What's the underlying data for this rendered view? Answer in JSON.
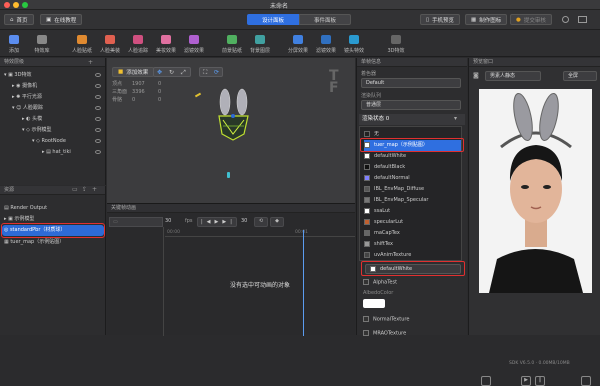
{
  "window": {
    "title": "未命名"
  },
  "topbar": {
    "home": "首页",
    "tutorial": "在线教程",
    "tab_design": "设计面板",
    "tab_event": "事件面板",
    "phone_preview": "手机预览",
    "make_icon": "制作图标",
    "submit_review": "提交审核"
  },
  "toolbar": [
    {
      "label": "添加"
    },
    {
      "label": "特效库"
    },
    {
      "label": "人脸贴纸"
    },
    {
      "label": "人脸美装"
    },
    {
      "label": "人脸追踪"
    },
    {
      "label": "美妆效果"
    },
    {
      "label": "滤镜效果"
    },
    {
      "label": "前景贴纸"
    },
    {
      "label": "背景图层"
    },
    {
      "label": "分屏效果"
    },
    {
      "label": "滤镜效果"
    },
    {
      "label": "镜头特效"
    },
    {
      "label": "3D特效"
    }
  ],
  "hierarchy": {
    "header": "特效层级",
    "items": [
      {
        "label": "3D特效"
      },
      {
        "label": "摄像机"
      },
      {
        "label": "平行光源"
      },
      {
        "label": "人脸跟踪"
      },
      {
        "label": "头模"
      },
      {
        "label": "示例模型"
      },
      {
        "label": "RootNode"
      },
      {
        "label": "hat_tiki"
      }
    ]
  },
  "resources": {
    "header": "资源",
    "items": [
      {
        "label": "Render Output"
      },
      {
        "label": "示例模型"
      },
      {
        "label": "standardPbr（材质球）"
      },
      {
        "label": "tuer_map（示例贴图）"
      }
    ]
  },
  "viewport": {
    "add_effect": "添加效果",
    "stats": [
      {
        "k": "顶点",
        "v": "1907",
        "x": "0"
      },
      {
        "k": "三角面",
        "v": "3396",
        "x": "0"
      },
      {
        "k": "骨骼",
        "v": "0",
        "x": "0"
      }
    ]
  },
  "timeline": {
    "header": "关键帧动画",
    "frames": "30",
    "fps_label": "fps",
    "frame_val": "30",
    "empty_msg": "没有选中可动画的对象",
    "ticks": [
      "00:00",
      "00:01"
    ]
  },
  "material": {
    "header": "单帧信息",
    "blend_label": "着色器",
    "blend_value": "Default",
    "queue_label": "渲染队列",
    "queue_value": "普通层",
    "state_label": "渲染状态 0",
    "list": [
      {
        "label": "无",
        "color": "#222222"
      },
      {
        "label": "tuer_map（示例贴图）",
        "color": "#ffffff"
      },
      {
        "label": "defaultWhite",
        "color": "#ffffff"
      },
      {
        "label": "defaultBlack",
        "color": "#111111"
      },
      {
        "label": "defaultNormal",
        "color": "#8080ff"
      },
      {
        "label": "IBL_EnvMap_Diffuse",
        "color": "#555555"
      },
      {
        "label": "IBL_EnvMap_Specular",
        "color": "#777777"
      },
      {
        "label": "ssaLut",
        "color": "#ffffff"
      },
      {
        "label": "specularLut",
        "color": "#c06030"
      },
      {
        "label": "maCapTex",
        "color": "#666666"
      },
      {
        "label": "shiftTex",
        "color": "#999999"
      },
      {
        "label": "uvAnimTexture",
        "color": "#444444"
      }
    ],
    "selected_tex": "defaultWhite",
    "alpha_test": "AlphaTest",
    "albedo_label": "AlbedoColor",
    "normal_tex": "NormalTexture",
    "mrao_tex": "MRAOTexture"
  },
  "preview": {
    "header": "预览窗口",
    "model_select": "男素人静态",
    "mode": "全屏",
    "sdk": "SDK V6.5.0 · 0.00MB/10MB"
  }
}
